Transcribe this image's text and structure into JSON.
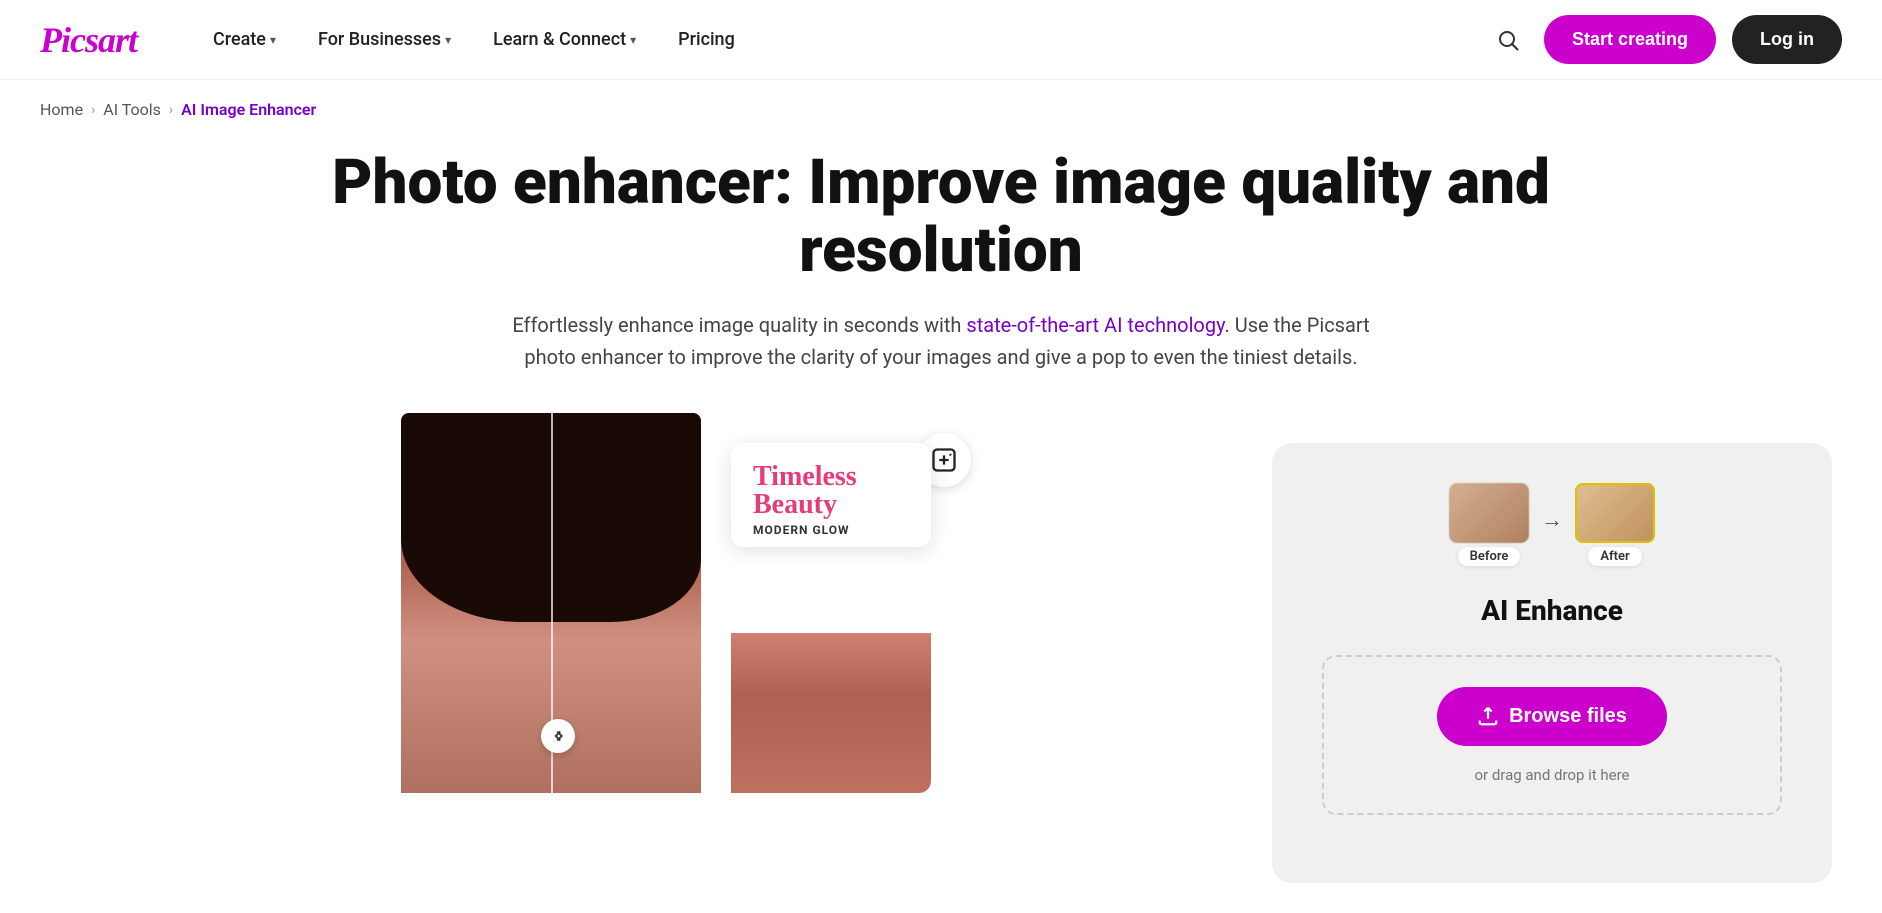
{
  "logo": {
    "text": "Picsart",
    "color": "#cc00cc"
  },
  "nav": {
    "items": [
      {
        "label": "Create",
        "has_chevron": true
      },
      {
        "label": "For Businesses",
        "has_chevron": true
      },
      {
        "label": "Learn & Connect",
        "has_chevron": true
      },
      {
        "label": "Pricing",
        "has_chevron": false
      }
    ],
    "start_creating": "Start creating",
    "login": "Log in"
  },
  "breadcrumb": {
    "items": [
      {
        "label": "Home",
        "active": false
      },
      {
        "label": "AI Tools",
        "active": false
      },
      {
        "label": "AI Image Enhancer",
        "active": true
      }
    ]
  },
  "hero": {
    "title": "Photo enhancer: Improve image quality and resolution",
    "subtitle": "Effortlessly enhance image quality in seconds with state-of-the-art AI technology. Use the Picsart photo enhancer to improve the clarity of your images and give a pop to even the tiniest details.",
    "highlight_words": "state-of-the-art AI technology"
  },
  "left_panel": {
    "overlay_card": {
      "title": "Timeless\nBeauty",
      "subtitle": "MODERN GLOW"
    }
  },
  "upload_widget": {
    "title": "AI Enhance",
    "before_label": "Before",
    "after_label": "After",
    "browse_label": "Browse files",
    "drop_text": "or drag and drop it here"
  }
}
